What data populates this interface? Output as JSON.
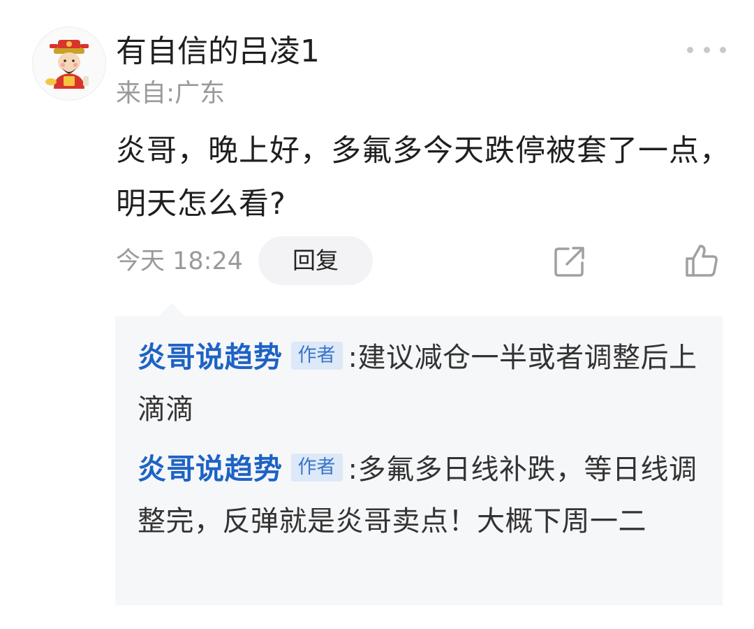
{
  "comment": {
    "username": "有自信的吕凌1",
    "location": "来自:广东",
    "text": "炎哥，晚上好，多氟多今天跌停被套了一点，明天怎么看?",
    "time": "今天 18:24",
    "reply_label": "回复",
    "more_icon": "more-dots-icon",
    "share_icon": "share-icon",
    "like_icon": "thumbs-up-icon"
  },
  "replies": [
    {
      "author": "炎哥说趋势",
      "badge": "作者",
      "text": ":建议减仓一半或者调整后上滴滴"
    },
    {
      "author": "炎哥说趋势",
      "badge": "作者",
      "text": ":多氟多日线补跌，等日线调整完，反弹就是炎哥卖点！大概下周一二"
    }
  ],
  "colors": {
    "author_blue": "#1e63c4",
    "muted_gray": "#9a9a9a",
    "reply_bg": "#f6f7f9"
  }
}
